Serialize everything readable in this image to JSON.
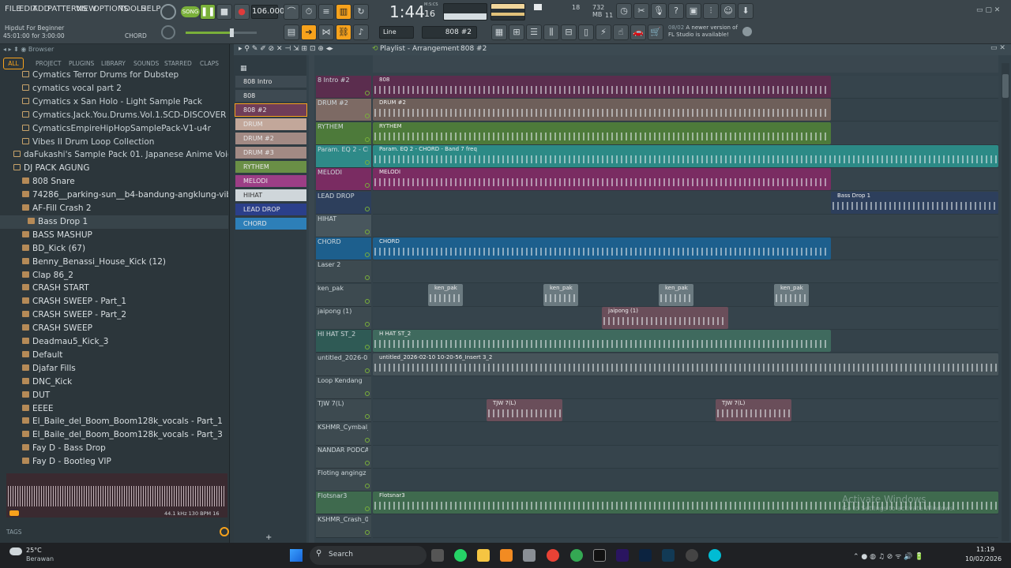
{
  "menu": [
    "FILE",
    "EDIT",
    "ADD",
    "PATTERNS",
    "VIEW",
    "OPTIONS",
    "TOOLS",
    "HELP"
  ],
  "transport": {
    "mode": "SONG",
    "tempo": "106.000",
    "time": "1:44",
    "time_sub": "16",
    "mcs": "M:S:CS",
    "cpu": "18",
    "mem": "732 MB",
    "voices": "11"
  },
  "hint": {
    "title": "Hipdut For Beginner",
    "pos": "45:01:00 for 3:00:00",
    "channel": "CHORD"
  },
  "toolbar2": {
    "snap": "Line",
    "pattern": "808 #2",
    "news_date": "08/02",
    "news_text": "A newer version of",
    "news_text2": "FL Studio is available!"
  },
  "browser": {
    "title": "Browser",
    "tabs": [
      "ALL",
      "PROJECT",
      "PLUGINS",
      "LIBRARY",
      "SOUNDS",
      "STARRED",
      "CLAPS"
    ],
    "items": [
      "Cymatics Terror Drums for Dubstep",
      "cymatics vocal part 2",
      "Cymatics x San Holo - Light Sample Pack",
      "Cymatics.Jack.You.Drums.Vol.1.SCD-DISCOVER",
      "CymaticsEmpireHipHopSamplePack-V1-u4r",
      "Vibes II Drum Loop Collection",
      "daFukashi's Sample Pack 01. Japanese Anime Voices & SEs",
      "DJ PACK AGUNG",
      "808 Snare",
      "74286__parking-sun__b4-bandung-angklung-vib",
      "AF-Fill Crash 2",
      "Bass Drop 1",
      "BASS MASHUP",
      "BD_Kick (67)",
      "Benny_Benassi_House_Kick (12)",
      "Clap 86_2",
      "CRASH START",
      "CRASH SWEEP - Part_1",
      "CRASH SWEEP - Part_2",
      "CRASH SWEEP",
      "Deadmau5_Kick_3",
      "Default",
      "Djafar Fills",
      "DNC_Kick",
      "DUT",
      "EEEE",
      "El_Baile_del_Boom_Boom128k_vocals - Part_1",
      "El_Baile_del_Boom_Boom128k_vocals - Part_3",
      "Fay D - Bass Drop",
      "Fay D - Bootleg VIP"
    ],
    "sample_info": "44.1 kHz 130 BPM 16",
    "tags": "TAGS"
  },
  "channels": [
    "808 Intro",
    "808",
    "808 #2",
    "DRUM",
    "DRUM #2",
    "DRUM #3",
    "RYTHEM",
    "MELODI",
    "HIHAT",
    "LEAD DROP",
    "CHORD"
  ],
  "playlist": {
    "title": "Playlist - Arrangement",
    "pattern": "808 #2",
    "tracks": [
      "8 Intro #2",
      "DRUM #2",
      "RYTHEM",
      "Param. EQ 2 - CHO",
      "MELODI",
      "LEAD DROP",
      "HIHAT",
      "CHORD",
      "Laser 2",
      "ken_pak",
      "jaipong (1)",
      "HI HAT ST_2",
      "untitled_2026-02",
      "Loop Kendang",
      "TJW 7(L)",
      "KSHMR_Cymbal_Tr",
      "NANDAR PODCATS S",
      "Floting angingz",
      "Flotsnar3",
      "KSHMR_Crash_07"
    ],
    "clip_labels": {
      "c808": "808",
      "drum": "DRUM #2",
      "rythem": "RYTHEM",
      "eq": "Param. EQ 2 - CHORD - Band 7 freq",
      "melodi": "MELODI",
      "bassdrop": "Bass Drop 1",
      "chord": "CHORD",
      "kenpak": "ken_pak",
      "jaipong": "jaipong (1)",
      "hihat": "H HAT ST_2",
      "untitled": "untitled_2026-02-10 10-20-56_Insert 3_2",
      "tjw": "TJW 7(L)",
      "flotsnar": "Flotsnar3"
    }
  },
  "watermark": {
    "line1": "Activate Windows",
    "line2": "Go to Settings to activate Windows."
  },
  "taskbar": {
    "temp": "25°C",
    "weather": "Berawan",
    "search": "Search",
    "time": "11:19",
    "date": "10/02/2026"
  },
  "colors": {
    "accent": "#f7a21c",
    "mixer_bg": "#34424a"
  }
}
